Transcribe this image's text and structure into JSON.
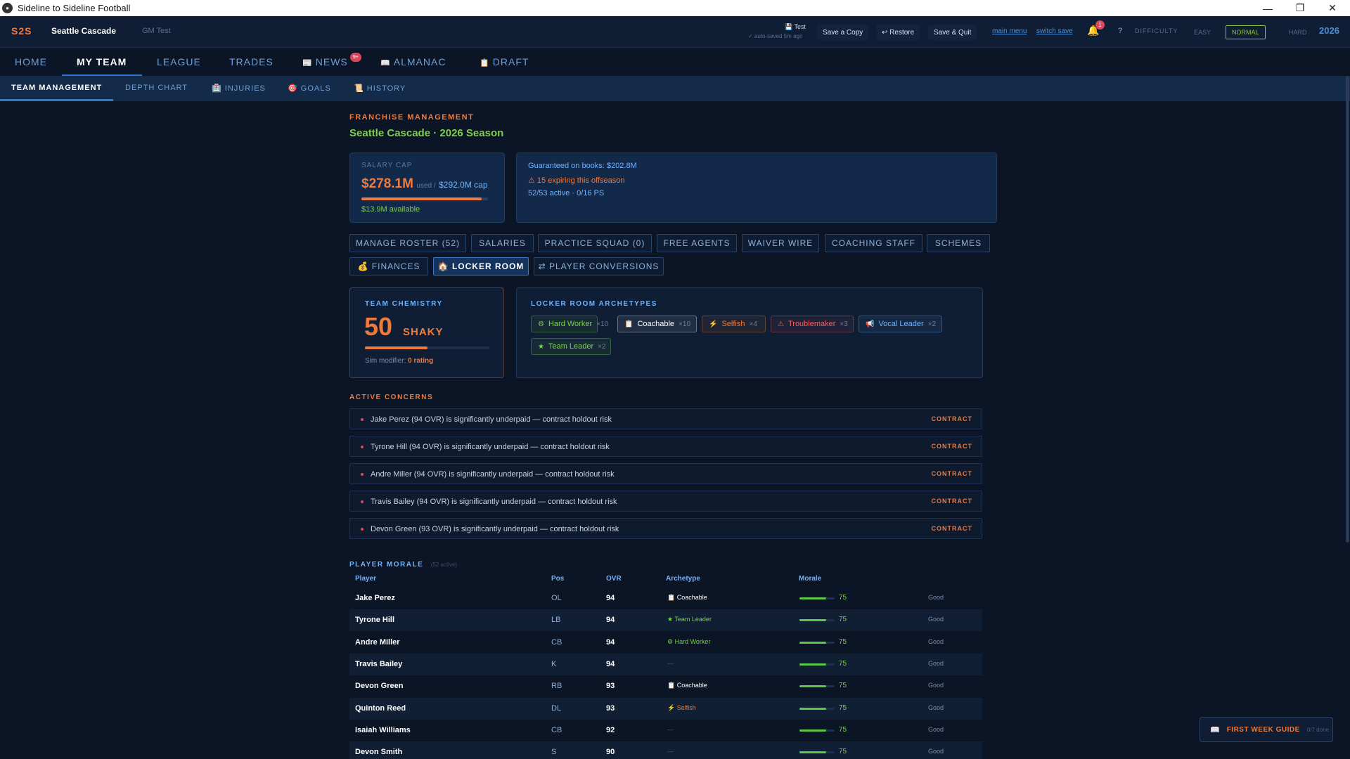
{
  "window": {
    "title": "Sideline to Sideline Football"
  },
  "header": {
    "logo": "S2S",
    "team": "Seattle Cascade",
    "gm": "GM Test",
    "save_slot": "Test",
    "autosave": "✓ auto-saved 5m ago",
    "buttons": {
      "save_copy": "Save a Copy",
      "restore": "↩ Restore",
      "save_quit": "Save & Quit"
    },
    "links": {
      "main_menu": "main menu",
      "switch_save": "switch save"
    },
    "notifications": "1",
    "help": "?",
    "difficulty_label": "DIFFICULTY",
    "difficulty_options": [
      "EASY",
      "NORMAL",
      "HARD"
    ],
    "difficulty_selected": "NORMAL",
    "year": "2026"
  },
  "nav": {
    "items": [
      "HOME",
      "MY TEAM",
      "LEAGUE",
      "TRADES",
      "NEWS",
      "ALMANAC",
      "DRAFT"
    ],
    "active": "MY TEAM",
    "news_badge": "9+"
  },
  "subnav": {
    "items": [
      "TEAM MANAGEMENT",
      "DEPTH CHART",
      "INJURIES",
      "GOALS",
      "HISTORY"
    ],
    "active": "TEAM MANAGEMENT"
  },
  "page": {
    "kicker": "FRANCHISE MANAGEMENT",
    "season": "Seattle Cascade · 2026 Season"
  },
  "cap": {
    "label": "SALARY CAP",
    "used": "$278.1M",
    "used_suffix": "used /",
    "total": "$292.0M cap",
    "usage_fraction": 0.952,
    "available": "$13.9M available"
  },
  "books": {
    "guaranteed": "Guaranteed on books: $202.8M",
    "expiring": "⚠ 15 expiring this offseason",
    "active": "52/53 active · 0/16 PS"
  },
  "tools": {
    "row1": [
      "MANAGE ROSTER (52)",
      "SALARIES",
      "PRACTICE SQUAD (0)",
      "FREE AGENTS",
      "WAIVER WIRE",
      "COACHING STAFF",
      "SCHEMES"
    ],
    "row2": [
      "💰 FINANCES",
      "🏠 LOCKER ROOM",
      "⇄ PLAYER CONVERSIONS"
    ],
    "active": "🏠 LOCKER ROOM"
  },
  "chemistry": {
    "label": "TEAM CHEMISTRY",
    "value": "50",
    "word": "SHAKY",
    "fill_fraction": 0.5,
    "sim_label": "Sim modifier:",
    "sim_value": "0 rating"
  },
  "archetypes": {
    "label": "LOCKER ROOM ARCHETYPES",
    "chips": [
      {
        "icon": "⚙",
        "name": "Hard Worker",
        "count": "×10",
        "color": "#7cd04a"
      },
      {
        "icon": "📋",
        "name": "Coachable",
        "count": "×10",
        "color": "#ffffff"
      },
      {
        "icon": "⚡",
        "name": "Selfish",
        "count": "×4",
        "color": "#f07a3a"
      },
      {
        "icon": "⚠",
        "name": "Troublemaker",
        "count": "×3",
        "color": "#f06060"
      },
      {
        "icon": "📢",
        "name": "Vocal Leader",
        "count": "×2",
        "color": "#6fb3ff"
      },
      {
        "icon": "★",
        "name": "Team Leader",
        "count": "×2",
        "color": "#7cd04a"
      }
    ]
  },
  "concerns": {
    "label": "ACTIVE CONCERNS",
    "items": [
      {
        "text": "Jake Perez (94 OVR) is significantly underpaid — contract holdout risk",
        "tag": "CONTRACT"
      },
      {
        "text": "Tyrone Hill (94 OVR) is significantly underpaid — contract holdout risk",
        "tag": "CONTRACT"
      },
      {
        "text": "Andre Miller (94 OVR) is significantly underpaid — contract holdout risk",
        "tag": "CONTRACT"
      },
      {
        "text": "Travis Bailey (94 OVR) is significantly underpaid — contract holdout risk",
        "tag": "CONTRACT"
      },
      {
        "text": "Devon Green (93 OVR) is significantly underpaid — contract holdout risk",
        "tag": "CONTRACT"
      }
    ]
  },
  "morale": {
    "label": "PLAYER MORALE",
    "count": "(52 active)",
    "columns": [
      "Player",
      "Pos",
      "OVR",
      "Archetype",
      "Morale"
    ],
    "rows": [
      {
        "name": "Jake Perez",
        "pos": "OL",
        "ovr": "94",
        "arch": "📋 Coachable",
        "arch_color": "#ffffff",
        "morale": "75",
        "morale_fraction": 0.75,
        "mood": "Good"
      },
      {
        "name": "Tyrone Hill",
        "pos": "LB",
        "ovr": "94",
        "arch": "★ Team Leader",
        "arch_color": "#7cd04a",
        "morale": "75",
        "morale_fraction": 0.75,
        "mood": "Good"
      },
      {
        "name": "Andre Miller",
        "pos": "CB",
        "ovr": "94",
        "arch": "⚙ Hard Worker",
        "arch_color": "#7cd04a",
        "morale": "75",
        "morale_fraction": 0.75,
        "mood": "Good"
      },
      {
        "name": "Travis Bailey",
        "pos": "K",
        "ovr": "94",
        "arch": "—",
        "arch_color": "#4a5c78",
        "morale": "75",
        "morale_fraction": 0.75,
        "mood": "Good"
      },
      {
        "name": "Devon Green",
        "pos": "RB",
        "ovr": "93",
        "arch": "📋 Coachable",
        "arch_color": "#ffffff",
        "morale": "75",
        "morale_fraction": 0.75,
        "mood": "Good"
      },
      {
        "name": "Quinton Reed",
        "pos": "DL",
        "ovr": "93",
        "arch": "⚡ Selfish",
        "arch_color": "#f07a3a",
        "morale": "75",
        "morale_fraction": 0.75,
        "mood": "Good"
      },
      {
        "name": "Isaiah Williams",
        "pos": "CB",
        "ovr": "92",
        "arch": "—",
        "arch_color": "#4a5c78",
        "morale": "75",
        "morale_fraction": 0.75,
        "mood": "Good"
      },
      {
        "name": "Devon Smith",
        "pos": "S",
        "ovr": "90",
        "arch": "—",
        "arch_color": "#4a5c78",
        "morale": "75",
        "morale_fraction": 0.75,
        "mood": "Good"
      }
    ]
  },
  "guide": {
    "title": "FIRST WEEK GUIDE",
    "progress": "0/7 done"
  }
}
